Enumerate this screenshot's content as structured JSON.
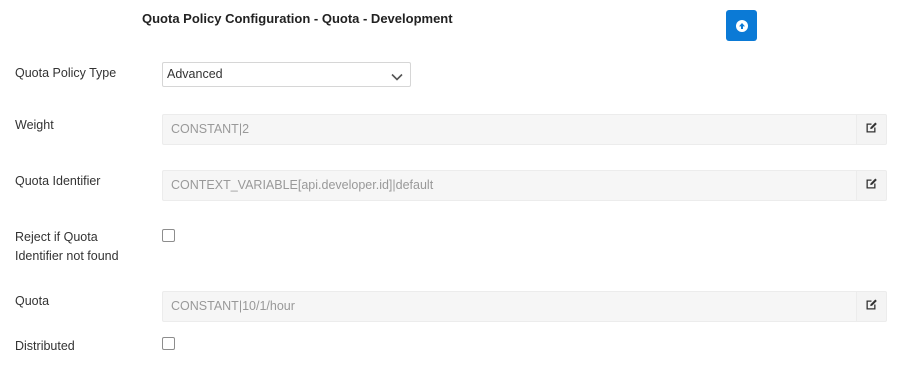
{
  "header": {
    "title": "Quota Policy Configuration - Quota - Development",
    "upload_icon": "arrow-up-circle-icon",
    "accent_color": "#0b7ad6"
  },
  "form": {
    "policy_type": {
      "label": "Quota Policy Type",
      "value": "Advanced"
    },
    "weight": {
      "label": "Weight",
      "value": "CONSTANT|2"
    },
    "identifier": {
      "label": "Quota Identifier",
      "value": "CONTEXT_VARIABLE[api.developer.id]|default"
    },
    "reject": {
      "label_line1": "Reject if Quota",
      "label_line2": "Identifier not found",
      "checked": false
    },
    "quota": {
      "label": "Quota",
      "value": "CONSTANT|10/1/hour"
    },
    "distributed": {
      "label": "Distributed",
      "checked": false
    },
    "edit_icon": "edit-icon"
  }
}
